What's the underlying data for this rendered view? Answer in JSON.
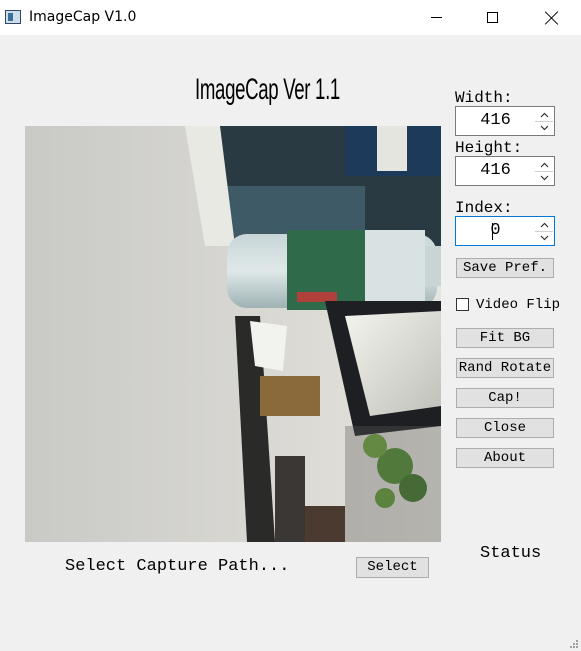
{
  "window": {
    "title": "ImageCap V1.0"
  },
  "heading": "ImageCap Ver 1.1",
  "preview": {
    "scene": "camera-frame-water-bottle"
  },
  "settings": {
    "width_label": "Width:",
    "width_value": "416",
    "height_label": "Height:",
    "height_value": "416",
    "index_label": "Index:",
    "index_value": "0"
  },
  "buttons": {
    "save_pref": "Save Pref.",
    "fit_bg": "Fit BG",
    "rand_rotate": "Rand Rotate",
    "cap": "Cap!",
    "close": "Close",
    "about": "About",
    "select": "Select"
  },
  "video_flip": {
    "label": "Video Flip",
    "checked": false
  },
  "capture_path_label": "Select Capture Path...",
  "status_text": "Status",
  "colors": {
    "window_bg": "#f0f0f0",
    "focus_border": "#0078d7",
    "button_face": "#e1e1e1"
  }
}
